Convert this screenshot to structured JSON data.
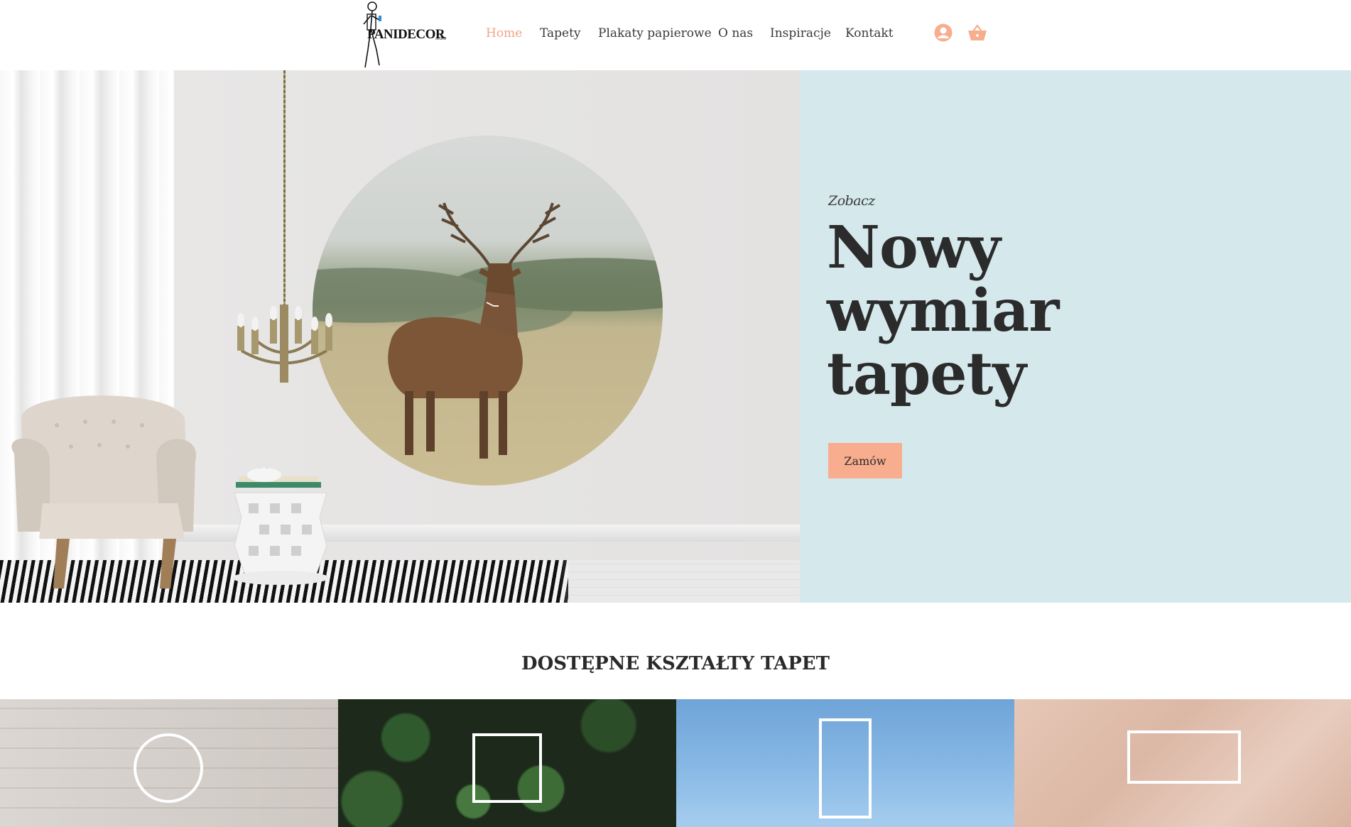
{
  "brand": {
    "logo_text": "PANIDECOR",
    "logo_suffix": ".com"
  },
  "nav": {
    "items": [
      {
        "label": "Home",
        "active": true
      },
      {
        "label": "Tapety",
        "active": false
      },
      {
        "label": "Plakaty papierowe",
        "active": false
      },
      {
        "label": "O nas",
        "active": false
      },
      {
        "label": "Inspiracje",
        "active": false
      },
      {
        "label": "Kontakt",
        "active": false
      }
    ]
  },
  "icons": {
    "user": "user-avatar-icon",
    "cart": "shopping-basket-icon"
  },
  "colors": {
    "accent": "#f7ad8e",
    "nav_active": "#f0a585",
    "hero_panel": "#d5e9ec",
    "text": "#2b2b2b"
  },
  "hero": {
    "kicker": "Zobacz",
    "title_line1": "Nowy",
    "title_line2": "wymiar",
    "title_line3": "tapety",
    "button_label": "Zamów"
  },
  "shapes_section": {
    "title": "DOSTĘPNE KSZTAŁTY TAPET",
    "tiles": [
      "circle",
      "square",
      "tall-rectangle",
      "wide-rectangle"
    ]
  }
}
